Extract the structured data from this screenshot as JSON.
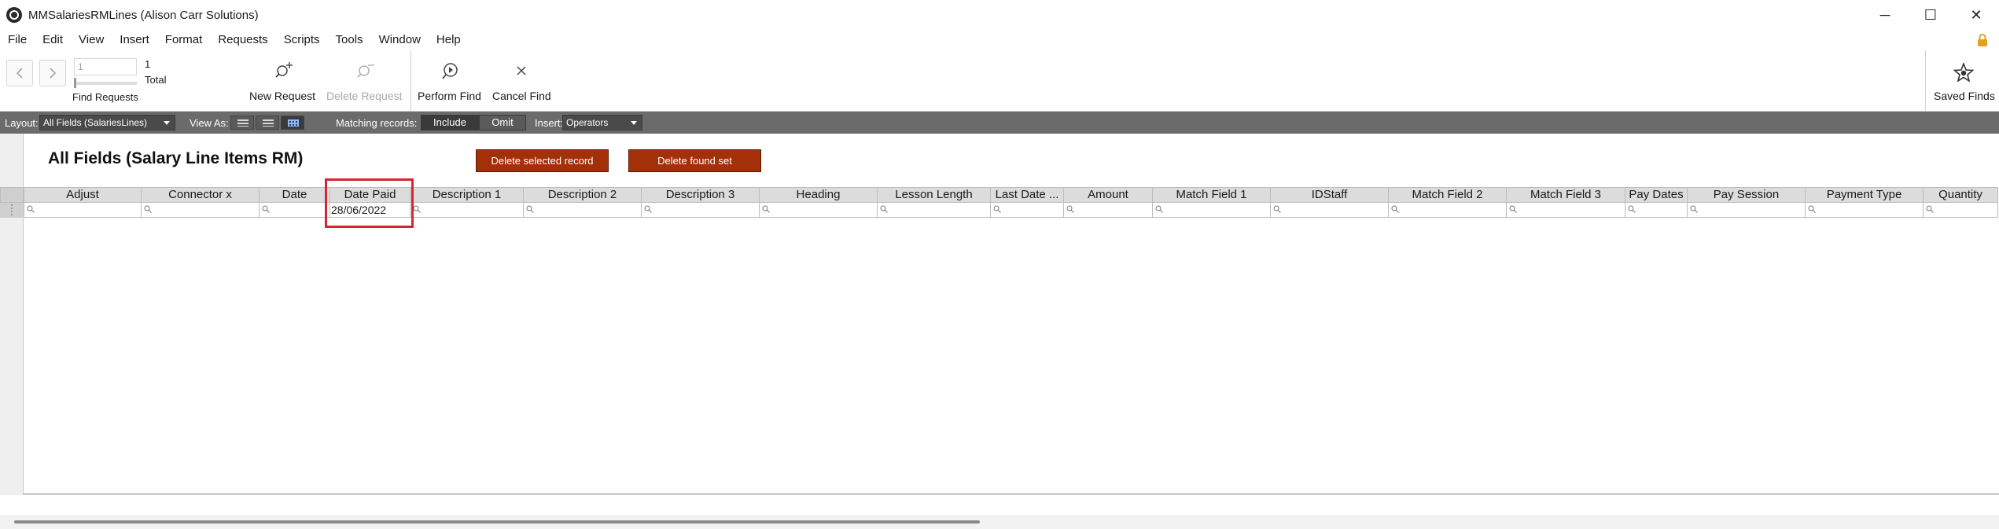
{
  "window": {
    "title": "MMSalariesRMLines (Alison Carr Solutions)",
    "controls": {
      "minimize": "─",
      "maximize": "☐",
      "close": "✕"
    }
  },
  "menu": [
    "File",
    "Edit",
    "View",
    "Insert",
    "Format",
    "Requests",
    "Scripts",
    "Tools",
    "Window",
    "Help"
  ],
  "toolbar": {
    "record_input": "1",
    "total_count": "1",
    "total_label": "Total",
    "find_requests_label": "Find Requests",
    "new_request": "New Request",
    "delete_request": "Delete Request",
    "perform_find": "Perform Find",
    "cancel_find": "Cancel Find",
    "saved_finds": "Saved Finds"
  },
  "layoutbar": {
    "layout_label": "Layout:",
    "layout_value": "All Fields (SalariesLines)",
    "view_as_label": "View As:",
    "matching_label": "Matching records:",
    "include": "Include",
    "omit": "Omit",
    "insert_label": "Insert:",
    "operators": "Operators"
  },
  "content": {
    "title": "All Fields (Salary Line Items RM)",
    "delete_selected": "Delete selected record",
    "delete_found": "Delete found set"
  },
  "table": {
    "columns": [
      "Adjust",
      "Connector x",
      "Date",
      "Date Paid",
      "Description 1",
      "Description 2",
      "Description 3",
      "Heading",
      "Lesson Length",
      "Last Date ...",
      "Amount",
      "Match Field 1",
      "IDStaff",
      "Match Field 2",
      "Match Field 3",
      "Pay Dates",
      "Pay Session",
      "Payment Type",
      "Quantity"
    ],
    "date_paid_value": "28/06/2022"
  },
  "colors": {
    "layout_bar": "#6b6b6b",
    "action_button": "#a4300a",
    "highlight": "#d3262f"
  }
}
